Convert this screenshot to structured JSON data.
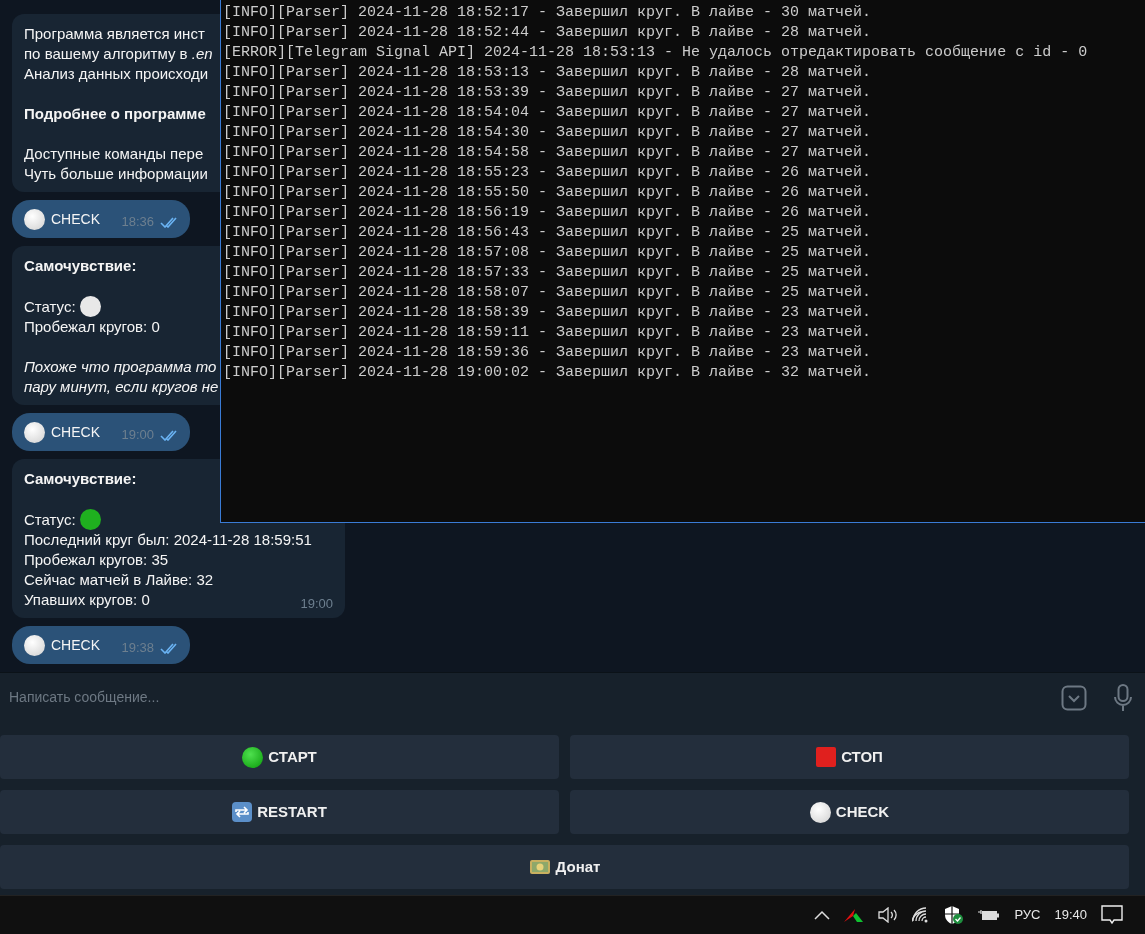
{
  "messages": [
    {
      "kind": "incoming",
      "paragraphs": [
        {
          "kind": "plain",
          "lines": [
            {
              "text": "Программа является инст"
            },
            {
              "text": "по вашему алгоритму в *.en*"
            },
            {
              "text": "Анализ данных происходи"
            }
          ]
        },
        {
          "kind": "bold",
          "lines": [
            {
              "text": "Подробнее о программе"
            }
          ]
        },
        {
          "kind": "plain",
          "lines": [
            {
              "text": "Доступные команды пере"
            },
            {
              "text": "Чуть больше информации"
            }
          ]
        }
      ]
    },
    {
      "kind": "outgoing",
      "text": "CHECK",
      "time": "18:36",
      "read": true
    },
    {
      "kind": "incoming",
      "paragraphs": [
        {
          "kind": "bold",
          "lines": [
            {
              "text": "Самочувствие:"
            }
          ]
        },
        {
          "kind": "plain",
          "lines": [
            {
              "text": "Статус:",
              "color": "#e8e8e8"
            },
            {
              "text": "Пробежал кругов: 0"
            }
          ]
        },
        {
          "kind": "italic",
          "lines": [
            {
              "text": "Похоже что программа то"
            },
            {
              "text": "пару минут, если кругов не"
            }
          ]
        }
      ]
    },
    {
      "kind": "outgoing",
      "text": "CHECK",
      "time": "19:00",
      "read": true
    },
    {
      "kind": "incoming",
      "time": "19:00",
      "paragraphs": [
        {
          "kind": "bold",
          "lines": [
            {
              "text": "Самочувствие:"
            }
          ]
        },
        {
          "kind": "plain",
          "lines": [
            {
              "text": "Статус:",
              "color": "#1fb01f"
            },
            {
              "text": "Последний круг был: 2024-11-28 18:59:51"
            },
            {
              "text": "Пробежал кругов: 35"
            },
            {
              "text": "Сейчас матчей в Лайве: 32"
            },
            {
              "text": "Упавших кругов: 0"
            }
          ]
        }
      ]
    },
    {
      "kind": "outgoing",
      "text": "CHECK",
      "time": "19:38",
      "read": true
    }
  ],
  "terminal": {
    "lines": [
      "[INFO][Parser] 2024-11-28 18:52:17 - Завершил круг. В лайве - 30 матчей.",
      "[INFO][Parser] 2024-11-28 18:52:44 - Завершил круг. В лайве - 28 матчей.",
      "[ERROR][Telegram Signal API] 2024-11-28 18:53:13 - Не удалось отредактировать сообщение с id - 0",
      "[INFO][Parser] 2024-11-28 18:53:13 - Завершил круг. В лайве - 28 матчей.",
      "[INFO][Parser] 2024-11-28 18:53:39 - Завершил круг. В лайве - 27 матчей.",
      "[INFO][Parser] 2024-11-28 18:54:04 - Завершил круг. В лайве - 27 матчей.",
      "[INFO][Parser] 2024-11-28 18:54:30 - Завершил круг. В лайве - 27 матчей.",
      "[INFO][Parser] 2024-11-28 18:54:58 - Завершил круг. В лайве - 27 матчей.",
      "[INFO][Parser] 2024-11-28 18:55:23 - Завершил круг. В лайве - 26 матчей.",
      "[INFO][Parser] 2024-11-28 18:55:50 - Завершил круг. В лайве - 26 матчей.",
      "[INFO][Parser] 2024-11-28 18:56:19 - Завершил круг. В лайве - 26 матчей.",
      "[INFO][Parser] 2024-11-28 18:56:43 - Завершил круг. В лайве - 25 матчей.",
      "[INFO][Parser] 2024-11-28 18:57:08 - Завершил круг. В лайве - 25 матчей.",
      "[INFO][Parser] 2024-11-28 18:57:33 - Завершил круг. В лайве - 25 матчей.",
      "[INFO][Parser] 2024-11-28 18:58:07 - Завершил круг. В лайве - 25 матчей.",
      "[INFO][Parser] 2024-11-28 18:58:39 - Завершил круг. В лайве - 23 матчей.",
      "[INFO][Parser] 2024-11-28 18:59:11 - Завершил круг. В лайве - 23 матчей.",
      "[INFO][Parser] 2024-11-28 18:59:36 - Завершил круг. В лайве - 23 матчей.",
      "[INFO][Parser] 2024-11-28 19:00:02 - Завершил круг. В лайве - 32 матчей."
    ]
  },
  "composer": {
    "placeholder": "Написать сообщение..."
  },
  "keyboard": [
    [
      {
        "label": "СТАРТ",
        "kind": "start"
      },
      {
        "label": "СТОП",
        "kind": "stop"
      }
    ],
    [
      {
        "label": "RESTART",
        "kind": "restart"
      },
      {
        "label": "CHECK",
        "kind": "check"
      }
    ],
    [
      {
        "label": "Донат",
        "kind": "donate"
      }
    ]
  ],
  "taskbar": {
    "language": "РУС",
    "clock": "19:40"
  }
}
